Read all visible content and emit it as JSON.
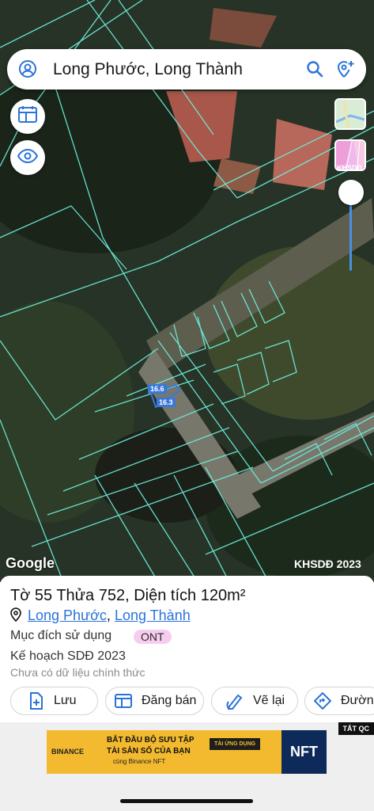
{
  "search": {
    "query": "Long Phước, Long Thành"
  },
  "map": {
    "logo": "Google",
    "layer_badge": "KHSDĐ",
    "layer_year_label": "KHSDĐ 2023",
    "measure_1": "16.6",
    "measure_2": "16.3",
    "icons": [
      "user-icon",
      "search-icon",
      "location-plus-icon",
      "layout-icon",
      "eye-icon"
    ]
  },
  "parcel": {
    "title": "Tờ 55 Thửa 752, Diện tích 120m²",
    "commune": "Long Phước",
    "separator": ",",
    "district": "Long Thành",
    "purpose_label": "Mục đích sử dụng",
    "purpose_code": "ONT",
    "plan_label": "Kế hoạch SDĐ 2023",
    "plan_note": "Chưa có dữ liệu chính thức"
  },
  "actions": [
    {
      "label": "Lưu",
      "icon": "doc-plus-icon"
    },
    {
      "label": "Đăng bán",
      "icon": "listing-icon"
    },
    {
      "label": "Vẽ lại",
      "icon": "pen-icon"
    },
    {
      "label": "Đường",
      "icon": "directions-icon"
    }
  ],
  "ad": {
    "close_label": "TẮT QC",
    "brand": "BINANCE",
    "line1": "BẮT ĐẦU BỘ SƯU TẬP",
    "line2": "TÀI SẢN SỐ CỦA BẠN",
    "line3": "cùng Binance NFT",
    "cta": "TẢI ỨNG DỤNG",
    "badge": "NFT"
  },
  "colors": {
    "accent": "#2a73d8",
    "parcel_lines": "#6df2e0",
    "badge_bg": "#f7cdef"
  }
}
